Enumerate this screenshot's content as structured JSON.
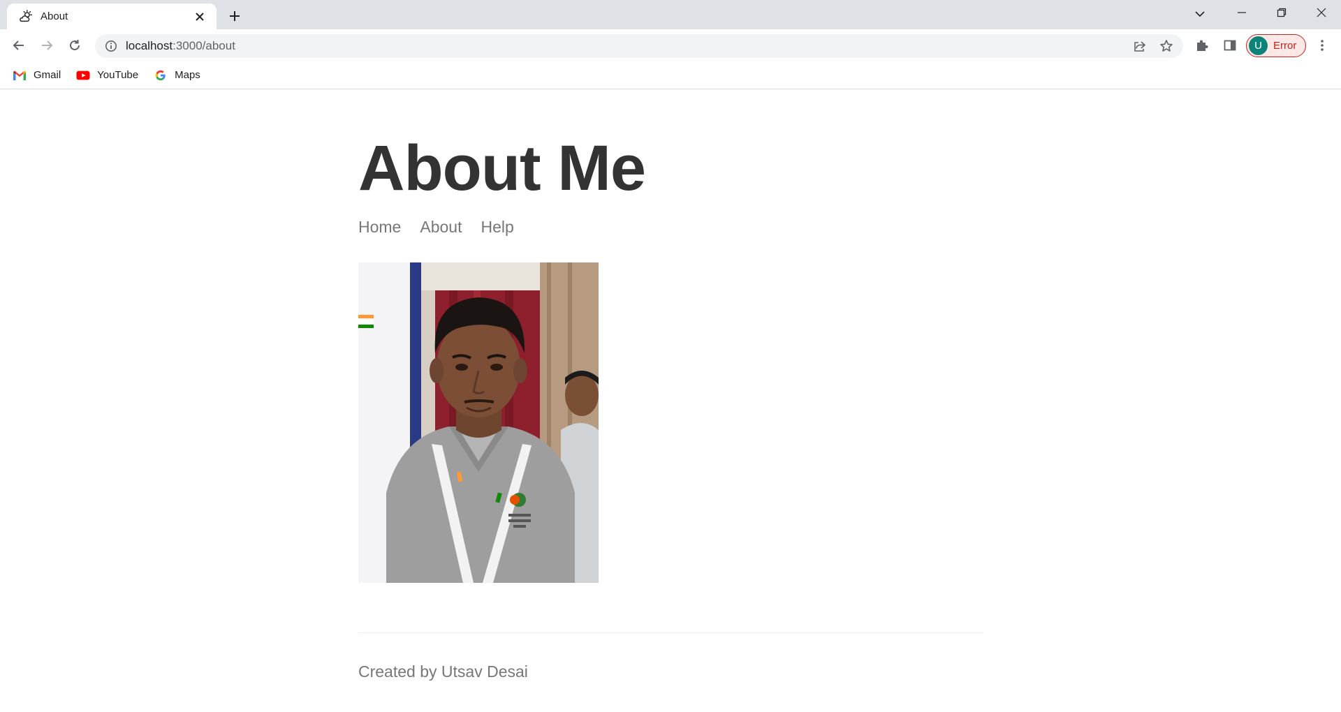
{
  "browser": {
    "tab": {
      "title": "About",
      "favicon": "weather-sun-cloud-icon"
    },
    "url": {
      "host": "localhost",
      "path": ":3000/about"
    },
    "profile": {
      "initial": "U",
      "label": "Error",
      "avatar_color": "#0b8379",
      "error_color": "#c5221f"
    },
    "bookmarks": [
      {
        "label": "Gmail",
        "icon": "gmail-icon"
      },
      {
        "label": "YouTube",
        "icon": "youtube-icon"
      },
      {
        "label": "Maps",
        "icon": "google-icon"
      }
    ]
  },
  "page": {
    "title": "About Me",
    "nav": [
      {
        "label": "Home"
      },
      {
        "label": "About"
      },
      {
        "label": "Help"
      }
    ],
    "photo": {
      "text_colors": {
        "lanyard": "#f2f2f2",
        "shirt": "#9e9e9e"
      }
    },
    "footer": "Created by Utsav Desai"
  }
}
